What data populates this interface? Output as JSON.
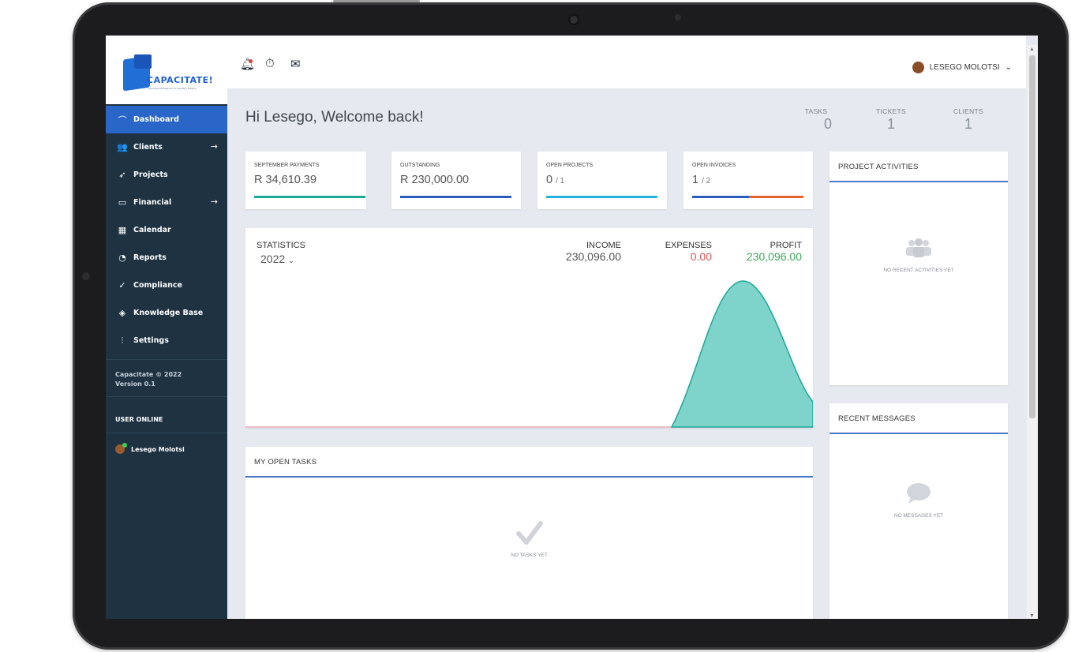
{
  "brand": {
    "name": "CAPACITATE!",
    "tagline": "Enterprise Management & Capability Building"
  },
  "sidebar": {
    "items": [
      {
        "label": "Dashboard",
        "icon": "dashboard-icon",
        "has_arrow": false
      },
      {
        "label": "Clients",
        "icon": "users-icon",
        "has_arrow": true
      },
      {
        "label": "Projects",
        "icon": "rocket-icon",
        "has_arrow": false
      },
      {
        "label": "Financial",
        "icon": "card-icon",
        "has_arrow": true
      },
      {
        "label": "Calendar",
        "icon": "calendar-icon",
        "has_arrow": false
      },
      {
        "label": "Reports",
        "icon": "reports-icon",
        "has_arrow": false
      },
      {
        "label": "Compliance",
        "icon": "check-icon",
        "has_arrow": false
      },
      {
        "label": "Knowledge Base",
        "icon": "graduation-cap-icon",
        "has_arrow": false
      },
      {
        "label": "Settings",
        "icon": "sliders-icon",
        "has_arrow": false
      }
    ],
    "footer_line1": "Capacitate © 2022",
    "footer_line2": "Version 0.1",
    "user_online_title": "USER ONLINE",
    "user_online_name": "Lesego Molotsi"
  },
  "header": {
    "user_name": "LESEGO MOLOTSI"
  },
  "welcome": "Hi Lesego, Welcome back!",
  "summary": {
    "tasks_label": "TASKS",
    "tasks_value": "0",
    "tickets_label": "TICKETS",
    "tickets_value": "1",
    "clients_label": "CLIENTS",
    "clients_value": "1"
  },
  "kpis": [
    {
      "label": "SEPTEMBER PAYMENTS",
      "value": "R 34,610.39",
      "sub": ""
    },
    {
      "label": "OUTSTANDING",
      "value": "R 230,000.00",
      "sub": ""
    },
    {
      "label": "OPEN PROJECTS",
      "value": "0",
      "sub": "/ 1"
    },
    {
      "label": "OPEN INVOICES",
      "value": "1",
      "sub": "/ 2"
    }
  ],
  "statistics": {
    "title": "STATISTICS",
    "year": "2022",
    "income_label": "INCOME",
    "income_value": "230,096.00",
    "expenses_label": "EXPENSES",
    "expenses_value": "0.00",
    "profit_label": "PROFIT",
    "profit_value": "230,096.00"
  },
  "colors": {
    "sidebar_bg": "#1e3242",
    "accent": "#2a66c8",
    "teal": "#1aa89a",
    "expense_red": "#e55353",
    "profit_green": "#3aa856"
  },
  "tasks_panel": {
    "title": "MY OPEN TASKS",
    "empty": "NO TASKS YET"
  },
  "activities_panel": {
    "title": "PROJECT ACTIVITIES",
    "empty": "NO RECENT ACTIVITIES YET"
  },
  "messages_panel": {
    "title": "RECENT MESSAGES",
    "empty": "NO MESSAGES YET"
  }
}
